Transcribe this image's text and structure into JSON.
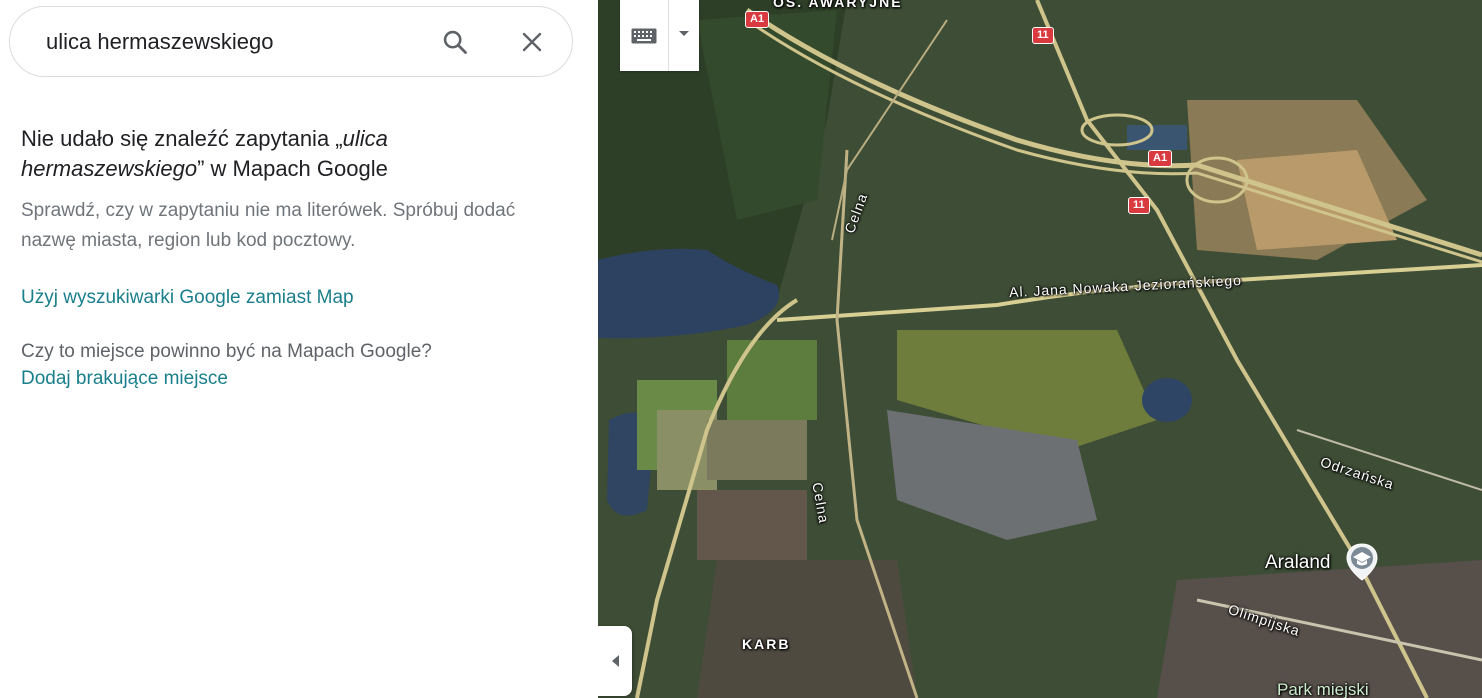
{
  "search": {
    "value": "ulica hermaszewskiego"
  },
  "results": {
    "heading_prefix": "Nie udało się znaleźć zapytania „",
    "heading_query": "ulica hermaszewskiego",
    "heading_suffix": "” w Mapach Google",
    "hint": "Sprawdź, czy w zapytaniu nie ma literówek. Spróbuj dodać nazwę miasta, region lub kod pocztowy.",
    "google_link": "Użyj wyszukiwarki Google zamiast Map",
    "question": "Czy to miejsce powinno być na Mapach Google?",
    "add_link": "Dodaj brakujące miejsce"
  },
  "map": {
    "labels": {
      "osiedle": "OS. AWARYJNE",
      "karb": "KARB",
      "celna_top": "Celna",
      "celna_bottom": "Celna",
      "nowaka": "Al. Jana Nowaka-Jeziorańskiego",
      "odrzanska": "Odrzańska",
      "olimpijska": "Olimpijska",
      "araland": "Araland",
      "park": "Park miejski"
    },
    "shields": {
      "a1_top": "A1",
      "a1_mid": "A1",
      "r11_top": "11",
      "r11_mid": "11"
    },
    "icons": {
      "keyboard": "keyboard-icon",
      "dropdown": "arrow-drop-down-icon",
      "collapse": "chevron-left-icon",
      "araland": "school-pin-icon"
    }
  },
  "colors": {
    "link": "#1a7f8c",
    "shield": "#d93a40"
  }
}
